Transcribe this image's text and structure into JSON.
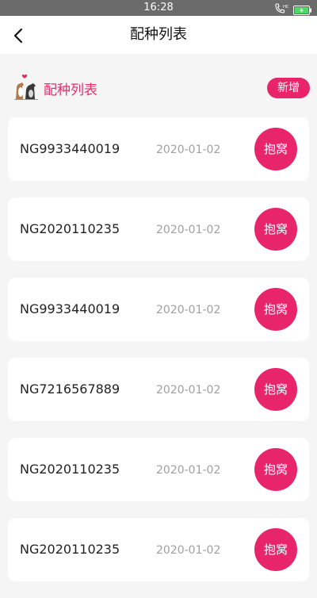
{
  "status_bar": {
    "time": "16:28"
  },
  "navbar": {
    "title": "配种列表"
  },
  "section": {
    "title": "配种列表",
    "add_label": "新增"
  },
  "records": [
    {
      "code": "NG9933440019",
      "date": "2020-01-02",
      "action": "抱窝"
    },
    {
      "code": "NG2020110235",
      "date": "2020-01-02",
      "action": "抱窝"
    },
    {
      "code": "NG9933440019",
      "date": "2020-01-02",
      "action": "抱窝"
    },
    {
      "code": "NG7216567889",
      "date": "2020-01-02",
      "action": "抱窝"
    },
    {
      "code": "NG2020110235",
      "date": "2020-01-02",
      "action": "抱窝"
    },
    {
      "code": "NG2020110235",
      "date": "2020-01-02",
      "action": "抱窝"
    }
  ],
  "colors": {
    "accent": "#e8246a",
    "title_pink": "#e2306c",
    "status_bar": "#6b6b6b"
  },
  "icons": [
    "back-arrow-icon",
    "call-hd-icon",
    "battery-charging-icon",
    "dog-couple-icon"
  ]
}
